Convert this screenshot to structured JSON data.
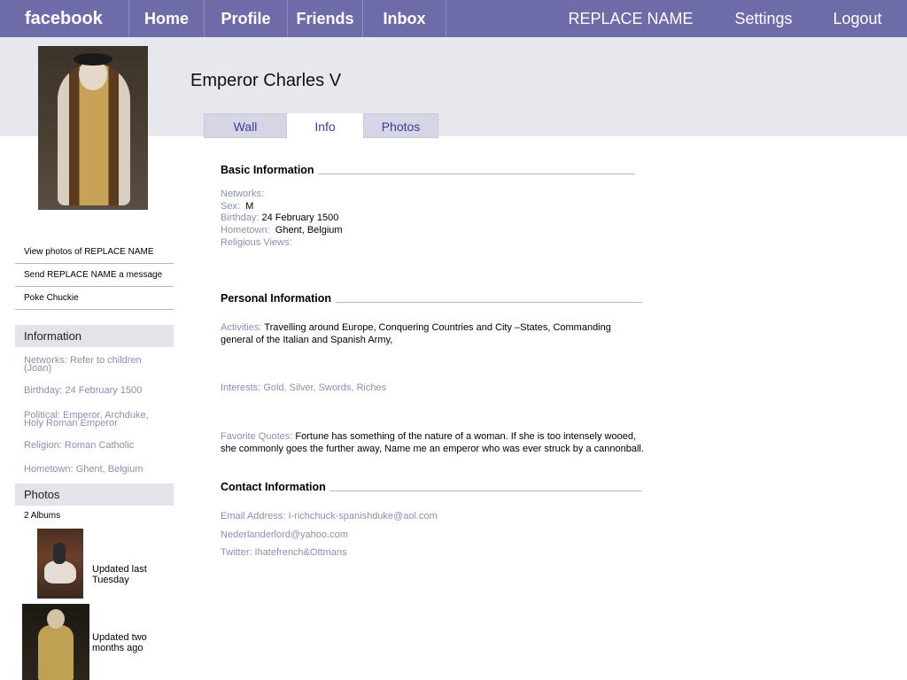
{
  "topbar": {
    "logo": "facebook",
    "nav": [
      "Home",
      "Profile",
      "Friends",
      "Inbox"
    ],
    "right": [
      "REPLACE NAME",
      "Settings",
      "Logout"
    ]
  },
  "profile": {
    "name": "Emperor Charles V",
    "tabs": [
      "Wall",
      "Info",
      "Photos"
    ],
    "active_tab": "Info"
  },
  "sidebar": {
    "links": [
      "View photos of REPLACE NAME",
      "Send REPLACE NAME a message",
      "Poke Chuckie"
    ],
    "info_heading": "Information",
    "info": [
      {
        "label": "Networks:",
        "value": "Refer to children (Joan)"
      },
      {
        "label": "Birthday:",
        "value": "24 February 1500"
      },
      {
        "label": "Political:",
        "value": "Emperor, Archduke, Holy Roman Emperor"
      },
      {
        "label": "Religion:",
        "value": "Roman Catholic"
      },
      {
        "label": "Hometown:",
        "value": "Ghent, Belgium"
      }
    ],
    "photos_heading": "Photos",
    "albums_count": "2 Albums",
    "albums": [
      {
        "caption": "Updated last Tuesday"
      },
      {
        "caption": "Updated two months ago"
      }
    ]
  },
  "basic": {
    "title": "Basic Information",
    "networks_label": "Networks:",
    "sex_label": "Sex:",
    "sex": "M",
    "birthday_label": "Birthday:",
    "birthday": "24 February 1500",
    "hometown_label": "Hometown:",
    "hometown": "Ghent, Belgium",
    "religious_label": "Religious Views:"
  },
  "personal": {
    "title": "Personal Information",
    "activities_label": "Activities:",
    "activities": "Travelling around Europe, Conquering Countries and  City –States, Commanding general of the Italian and Spanish Army,",
    "interests_label": "Interests:",
    "interests": "Gold, Silver, Swords, Riches",
    "quotes_label": "Favorite Quotes:",
    "quotes": "Fortune has something of the nature of a woman. If she is too intensely wooed, she commonly goes the further away, Name me an emperor who was ever struck by a cannonball."
  },
  "contact": {
    "title": "Contact Information",
    "email_label": "Email Address:",
    "email": "I-richchuck-spanishduke@aol.com",
    "email2": "Nederlanderlord@yahoo.com",
    "twitter_label": "Twitter:",
    "twitter": "Ihatefrench&Ottmans"
  }
}
